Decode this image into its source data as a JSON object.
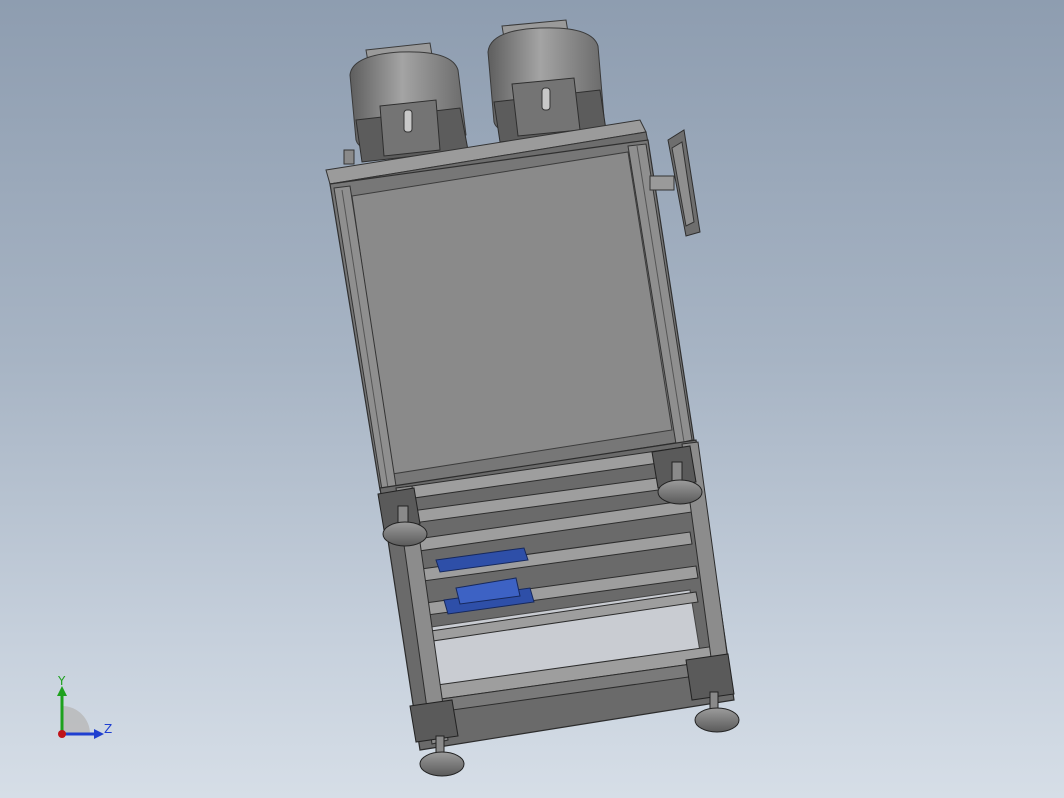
{
  "view": {
    "colors": {
      "background_top": "#8e9db0",
      "background_bottom": "#d6dee7",
      "frame": "#7c7c7c",
      "frame_dark": "#4f4f4f",
      "panel": "#8a8a8a",
      "motor": "#8c8c8c",
      "accent_blue": "#2e4fa8"
    }
  },
  "triad": {
    "y_label": "Y",
    "z_label": "Z",
    "y_color": "#1ea11e",
    "z_color": "#1f3fd0",
    "x_color": "#c0141a"
  }
}
